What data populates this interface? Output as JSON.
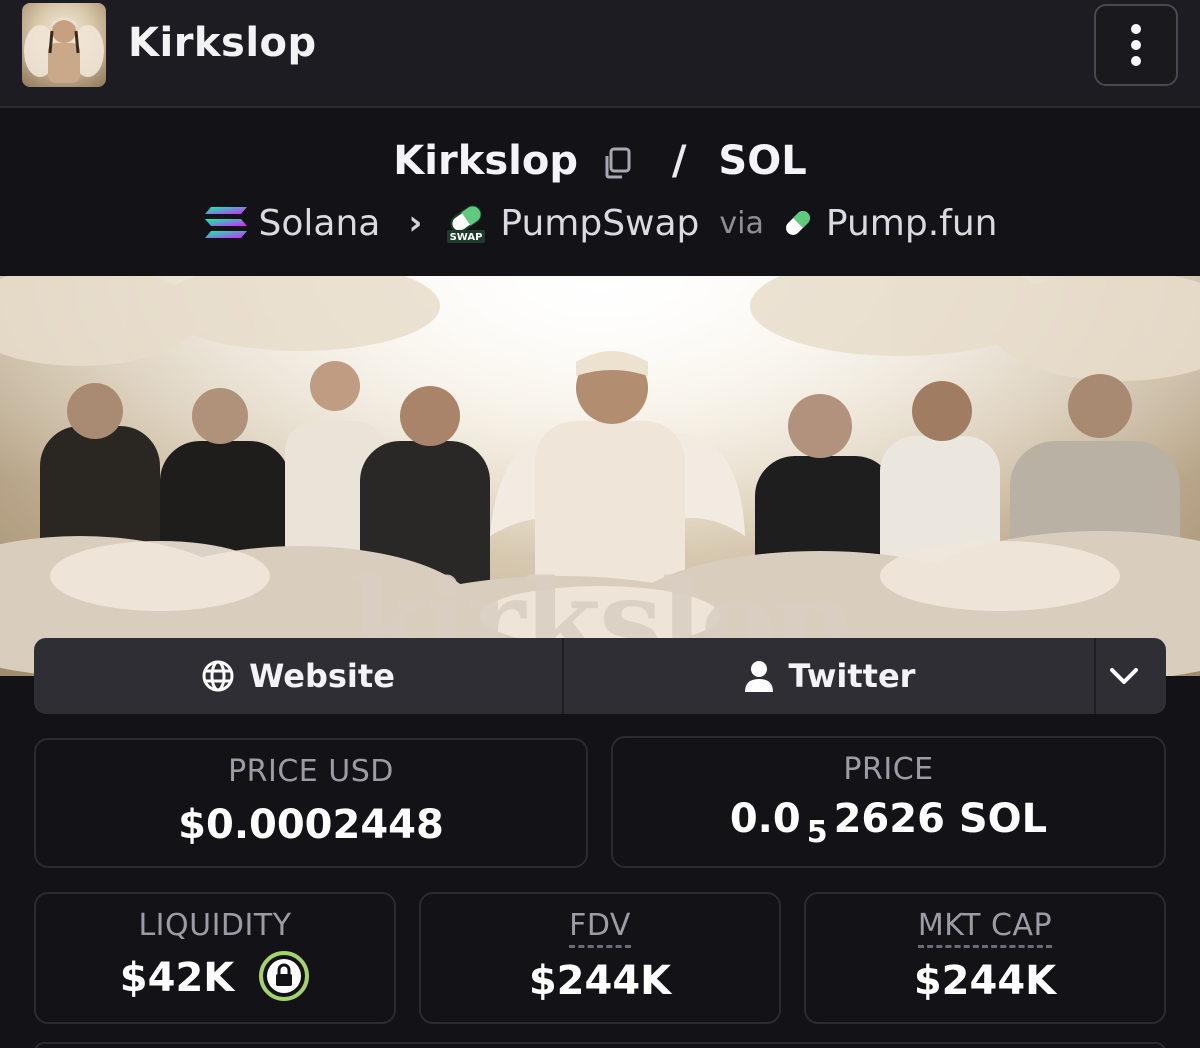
{
  "app": {
    "title": "Kirkslop"
  },
  "pair": {
    "base": "Kirkslop",
    "separator": "/",
    "quote": "SOL",
    "chain": "Solana",
    "dex": "PumpSwap",
    "dex_badge": "SWAP",
    "via_label": "via",
    "launchpad": "Pump.fun"
  },
  "banner": {
    "word": "kirkslop"
  },
  "links": {
    "website_label": "Website",
    "twitter_label": "Twitter",
    "icons": [
      "globe-icon",
      "user-icon",
      "chevron-down-icon"
    ]
  },
  "stats": {
    "price_usd": {
      "label": "PRICE USD",
      "value": "$0.0002448"
    },
    "price": {
      "label": "PRICE",
      "prefix": "0.0",
      "zeros": "5",
      "digits": "2626",
      "unit": "SOL"
    },
    "liquidity": {
      "label": "LIQUIDITY",
      "value": "$42K",
      "locked": true
    },
    "fdv": {
      "label": "FDV",
      "value": "$244K"
    },
    "mkt_cap": {
      "label": "MKT CAP",
      "value": "$244K"
    }
  },
  "colors": {
    "background": "#131217",
    "topbar": "#1d1c22",
    "card_border": "#2c2b32",
    "label": "#9d9ca6",
    "lock_green": "#a3d46a"
  }
}
